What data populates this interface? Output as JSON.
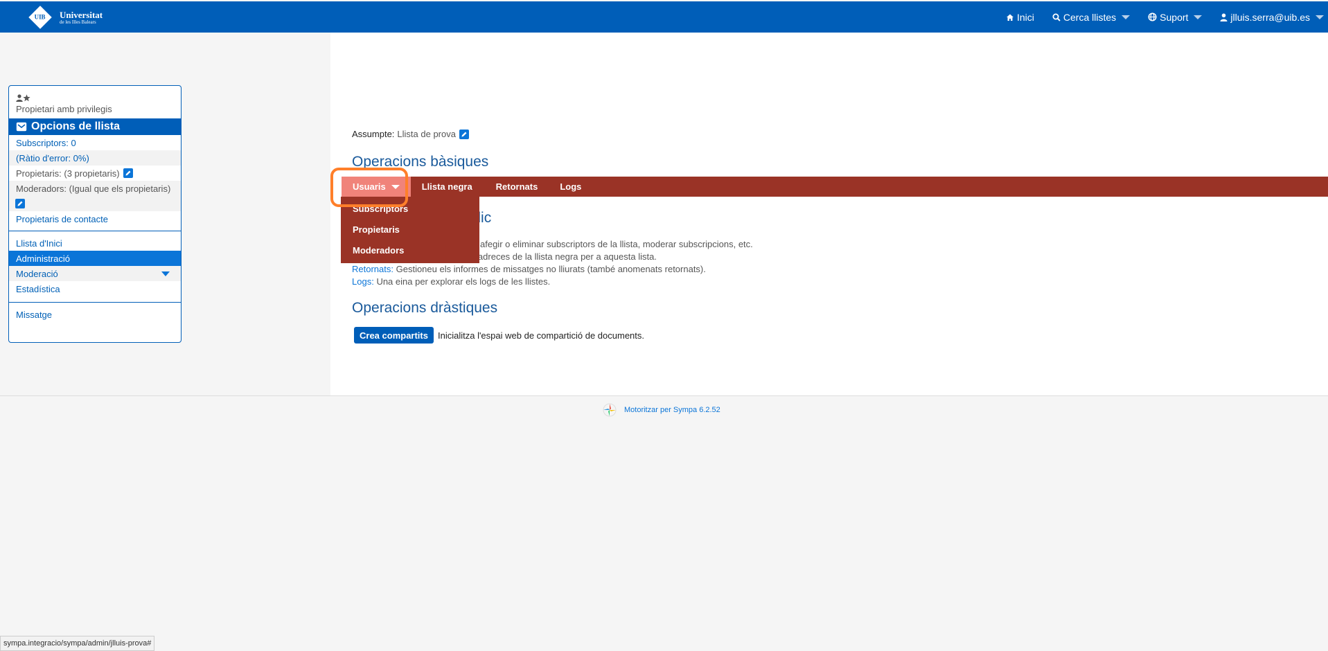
{
  "header": {
    "logo_short": "UIB",
    "logo_line1": "Universitat",
    "logo_line2": "de les Illes Balears",
    "nav": [
      {
        "label": "Inici",
        "icon": "home-icon"
      },
      {
        "label": "Cerca llistes",
        "icon": "search-icon"
      },
      {
        "label": "Suport",
        "icon": "globe-icon"
      },
      {
        "label": "jlluis.serra@uib.es",
        "icon": "user-icon"
      }
    ]
  },
  "sidebar": {
    "role": "Propietari amb privilegis",
    "title": "Opcions de llista",
    "info": {
      "subscribers": "Subscriptors: 0",
      "error_ratio": "(Ràtio d'error: 0%)",
      "owners": "Propietaris: (3 propietaris)",
      "moderators": "Moderadors: (Igual que els propietaris)",
      "contact_owners": "Propietaris de contacte"
    },
    "nav": {
      "home": "Llista d'Inici",
      "admin": "Administració",
      "moderation": "Moderació",
      "stats": "Estadística",
      "message": "Missatge"
    }
  },
  "content": {
    "subject_label": "Assumpte:",
    "subject_value": "Llista de prova",
    "basic_title": "Operacions bàsiques",
    "tabs": [
      "Usuaris",
      "Llista negra",
      "Retornats",
      "Logs"
    ],
    "dropdown": [
      "Subscriptors",
      "Propietaris",
      "Moderadors"
    ],
    "occasional_title_visible": "oràdic",
    "desc_users_tail": "afegir o eliminar subscriptors de la llista, moderar subscripcions, etc.",
    "desc_blacklist_tail": "t d'adreces de la llista negra per a aquesta lista.",
    "desc_bounces_link": "Retornats:",
    "desc_bounces": "Gestioneu els informes de missatges no lliurats (també anomenats retornats).",
    "desc_logs_link": "Logs:",
    "desc_logs": "Una eina per explorar els logs de les llistes.",
    "drastic_title": "Operacions dràstiques",
    "share_button": "Crea compartits",
    "share_desc": "Inicialitza l'espai web de compartició de documents."
  },
  "footer": {
    "powered": "Motoritzar per Sympa 6.2.52"
  },
  "statusbar": {
    "url": "sympa.integracio/sympa/admin/jlluis-prova#"
  },
  "colors": {
    "brand": "#005eb8",
    "opbar": "#9a3326",
    "active_tab": "#f0837a",
    "highlight": "#ff7f2a"
  }
}
